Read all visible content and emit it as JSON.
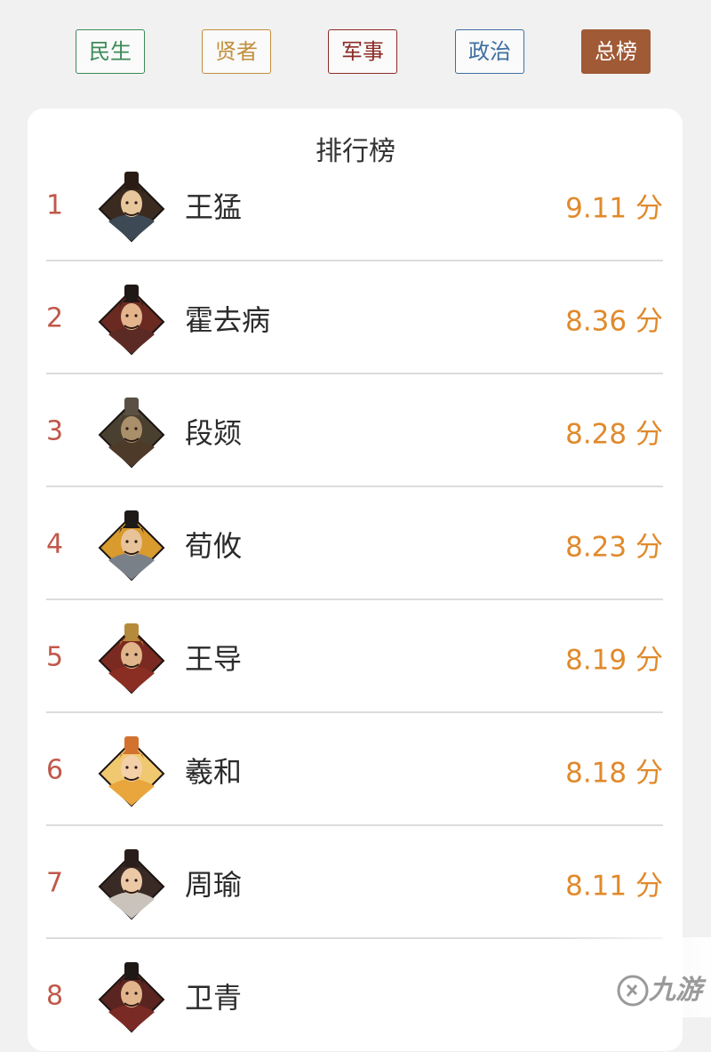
{
  "tabs": [
    {
      "label": "民生"
    },
    {
      "label": "贤者"
    },
    {
      "label": "军事"
    },
    {
      "label": "政治"
    },
    {
      "label": "总榜",
      "active": true
    }
  ],
  "board": {
    "title": "排行榜",
    "rows": [
      {
        "rank": "1",
        "name": "王猛",
        "score": "9.11 分",
        "avatar": "portrait-icon",
        "palette": {
          "bg": "#3a2a20",
          "face": "#e9c79c",
          "hat": "#2a1c14",
          "robe": "#3d4a55"
        }
      },
      {
        "rank": "2",
        "name": "霍去病",
        "score": "8.36 分",
        "avatar": "portrait-icon",
        "palette": {
          "bg": "#6a2a22",
          "face": "#e4b48d",
          "hat": "#1f1816",
          "robe": "#5c2a24"
        }
      },
      {
        "rank": "3",
        "name": "段颎",
        "score": "8.28 分",
        "avatar": "portrait-icon",
        "palette": {
          "bg": "#4a4030",
          "face": "#a98f6a",
          "hat": "#5a5044",
          "robe": "#4e3a28"
        }
      },
      {
        "rank": "4",
        "name": "荀攸",
        "score": "8.23 分",
        "avatar": "portrait-icon",
        "palette": {
          "bg": "#d99a2e",
          "face": "#e8c39a",
          "hat": "#1e1a18",
          "robe": "#7a8088"
        }
      },
      {
        "rank": "5",
        "name": "王导",
        "score": "8.19 分",
        "avatar": "portrait-icon",
        "palette": {
          "bg": "#7a2a20",
          "face": "#e1b58a",
          "hat": "#b58a3a",
          "robe": "#8a2d22"
        }
      },
      {
        "rank": "6",
        "name": "羲和",
        "score": "8.18 分",
        "avatar": "portrait-icon",
        "palette": {
          "bg": "#f0c870",
          "face": "#f3d0a8",
          "hat": "#d2722e",
          "robe": "#e9a63c"
        }
      },
      {
        "rank": "7",
        "name": "周瑜",
        "score": "8.11 分",
        "avatar": "portrait-icon",
        "palette": {
          "bg": "#3a2a26",
          "face": "#ecc9a6",
          "hat": "#2a1e1c",
          "robe": "#c9c3bb"
        }
      },
      {
        "rank": "8",
        "name": "卫青",
        "score": "",
        "avatar": "portrait-icon",
        "palette": {
          "bg": "#5a2420",
          "face": "#e2b58c",
          "hat": "#1e1816",
          "robe": "#7a2a24"
        }
      }
    ]
  },
  "watermark": {
    "text": "九游",
    "logo": "jiuyou-logo-icon"
  }
}
